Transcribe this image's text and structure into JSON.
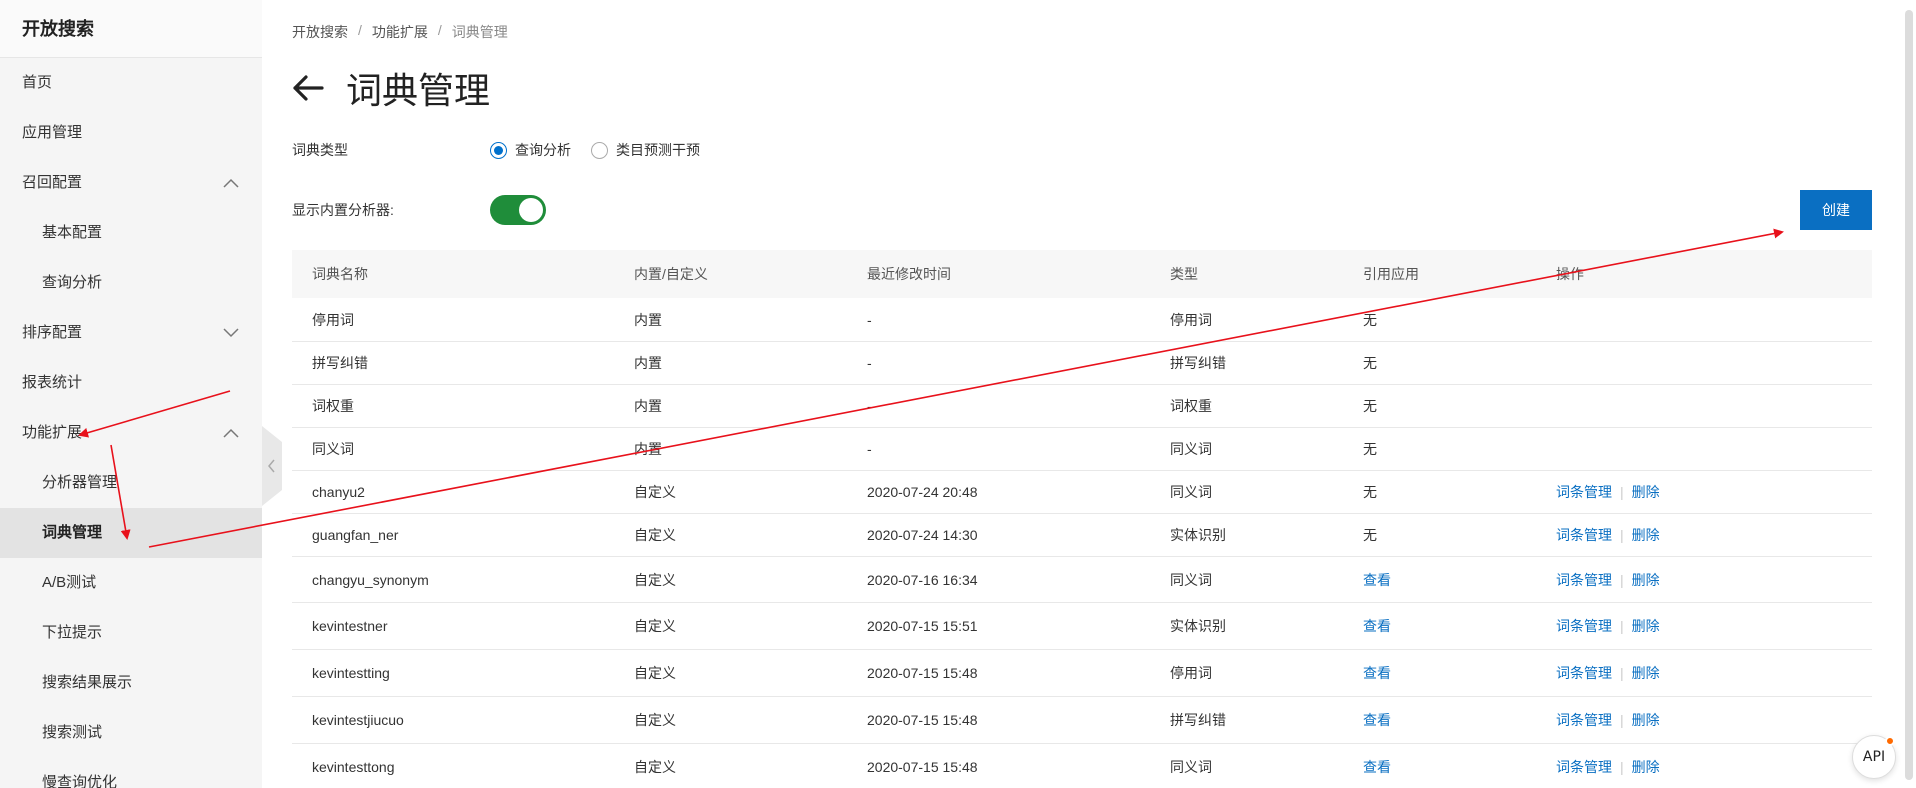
{
  "app": {
    "title": "开放搜索"
  },
  "sidebar": {
    "items": [
      {
        "label": "首页",
        "level": 1
      },
      {
        "label": "应用管理",
        "level": 1
      },
      {
        "label": "召回配置",
        "level": 1,
        "chevron": "chevron-up-icon"
      },
      {
        "label": "基本配置",
        "level": 2
      },
      {
        "label": "查询分析",
        "level": 2
      },
      {
        "label": "排序配置",
        "level": 1,
        "chevron": "chevron-down-icon"
      },
      {
        "label": "报表统计",
        "level": 1
      },
      {
        "label": "功能扩展",
        "level": 1,
        "chevron": "chevron-up-icon"
      },
      {
        "label": "分析器管理",
        "level": 2
      },
      {
        "label": "词典管理",
        "level": 2,
        "active": true
      },
      {
        "label": "A/B测试",
        "level": 2
      },
      {
        "label": "下拉提示",
        "level": 2
      },
      {
        "label": "搜索结果展示",
        "level": 2
      },
      {
        "label": "搜索测试",
        "level": 2
      },
      {
        "label": "慢查询优化",
        "level": 2
      }
    ]
  },
  "breadcrumb": {
    "items": [
      "开放搜索",
      "功能扩展",
      "词典管理"
    ],
    "separator": "/"
  },
  "page": {
    "title": "词典管理",
    "back_icon": "arrow-left-icon"
  },
  "filters": {
    "dict_type_label": "词典类型",
    "options": [
      "查询分析",
      "类目预测干预"
    ],
    "selected": "查询分析",
    "builtin_label": "显示内置分析器:",
    "builtin_on": true
  },
  "toolbar": {
    "create_label": "创建"
  },
  "table": {
    "columns": [
      "词典名称",
      "内置/自定义",
      "最近修改时间",
      "类型",
      "引用应用",
      "操作"
    ],
    "rows": [
      {
        "name": "停用词",
        "kind": "内置",
        "modified": "-",
        "type": "停用词",
        "ref": "无",
        "ref_link": false,
        "ops": []
      },
      {
        "name": "拼写纠错",
        "kind": "内置",
        "modified": "-",
        "type": "拼写纠错",
        "ref": "无",
        "ref_link": false,
        "ops": []
      },
      {
        "name": "词权重",
        "kind": "内置",
        "modified": "-",
        "type": "词权重",
        "ref": "无",
        "ref_link": false,
        "ops": []
      },
      {
        "name": "同义词",
        "kind": "内置",
        "modified": "-",
        "type": "同义词",
        "ref": "无",
        "ref_link": false,
        "ops": []
      },
      {
        "name": "chanyu2",
        "kind": "自定义",
        "modified": "2020-07-24 20:48",
        "type": "同义词",
        "ref": "无",
        "ref_link": false,
        "ops": [
          "词条管理",
          "删除"
        ]
      },
      {
        "name": "guangfan_ner",
        "kind": "自定义",
        "modified": "2020-07-24 14:30",
        "type": "实体识别",
        "ref": "无",
        "ref_link": false,
        "ops": [
          "词条管理",
          "删除"
        ]
      },
      {
        "name": "changyu_synonym",
        "kind": "自定义",
        "modified": "2020-07-16 16:34",
        "type": "同义词",
        "ref": "查看",
        "ref_link": true,
        "ops": [
          "词条管理",
          "删除"
        ]
      },
      {
        "name": "kevintestner",
        "kind": "自定义",
        "modified": "2020-07-15 15:51",
        "type": "实体识别",
        "ref": "查看",
        "ref_link": true,
        "ops": [
          "词条管理",
          "删除"
        ]
      },
      {
        "name": "kevintestting",
        "kind": "自定义",
        "modified": "2020-07-15 15:48",
        "type": "停用词",
        "ref": "查看",
        "ref_link": true,
        "ops": [
          "词条管理",
          "删除"
        ]
      },
      {
        "name": "kevintestjiucuo",
        "kind": "自定义",
        "modified": "2020-07-15 15:48",
        "type": "拼写纠错",
        "ref": "查看",
        "ref_link": true,
        "ops": [
          "词条管理",
          "删除"
        ]
      },
      {
        "name": "kevintesttong",
        "kind": "自定义",
        "modified": "2020-07-15 15:48",
        "type": "同义词",
        "ref": "查看",
        "ref_link": true,
        "ops": [
          "词条管理",
          "删除"
        ]
      }
    ]
  },
  "api_badge": {
    "label": "API"
  },
  "colors": {
    "accent": "#0a6fc2",
    "toggle_on": "#1f8d3a",
    "annotation": "#e8111b"
  }
}
